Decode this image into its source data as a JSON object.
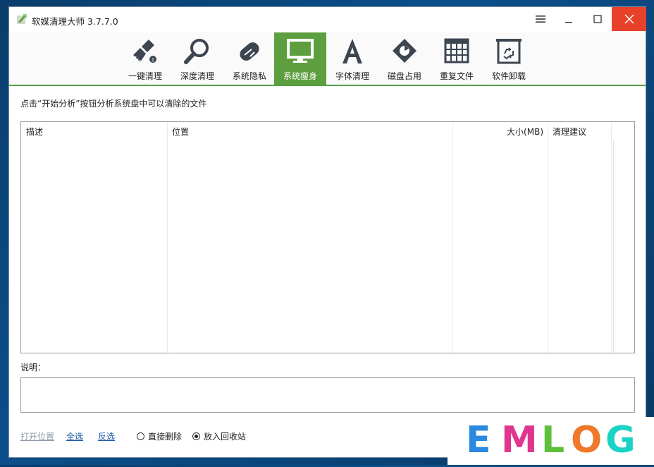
{
  "window": {
    "title": "软媒清理大师 3.7.7.0"
  },
  "toolbar": {
    "items": [
      {
        "label": "一键清理",
        "icon": "broom-icon"
      },
      {
        "label": "深度清理",
        "icon": "magnifier-icon"
      },
      {
        "label": "系统隐私",
        "icon": "privacy-pill-icon"
      },
      {
        "label": "系统瘦身",
        "icon": "monitor-icon",
        "active": true
      },
      {
        "label": "字体清理",
        "icon": "font-a-icon"
      },
      {
        "label": "磁盘占用",
        "icon": "disk-tag-icon"
      },
      {
        "label": "重复文件",
        "icon": "grid-file-icon"
      },
      {
        "label": "软件卸载",
        "icon": "recycle-bin-icon"
      }
    ]
  },
  "main": {
    "hint": "点击“开始分析”按钮分析系统盘中可以清除的文件",
    "columns": [
      "描述",
      "位置",
      "大小(MB)",
      "清理建议"
    ],
    "description_label": "说明："
  },
  "footer": {
    "open_location": "打开位置",
    "select_all": "全选",
    "invert_select": "反选",
    "radio_direct_delete": "直接删除",
    "radio_recycle": "放入回收站",
    "selected_radio": "放入回收站"
  },
  "watermark": {
    "text": "EMLOG",
    "letters": [
      "E",
      "M",
      "L",
      "O",
      "G"
    ],
    "colors": [
      "#2a8ae0",
      "#e0368f",
      "#5cc03a",
      "#f0782a",
      "#1ad3c5"
    ]
  },
  "colors": {
    "accent_green": "#5d9e3e",
    "close_red": "#e8412a"
  }
}
